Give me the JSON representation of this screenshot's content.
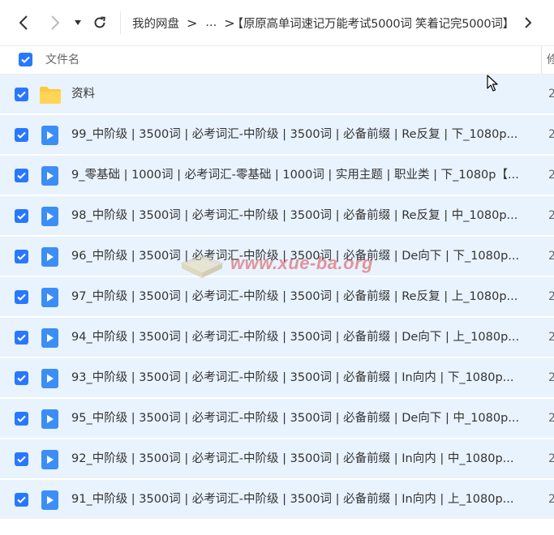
{
  "nav": {
    "back_icon": "chevron-left-icon",
    "forward_icon": "chevron-right-icon",
    "dropdown_icon": "caret-down-icon",
    "refresh_icon": "refresh-icon"
  },
  "breadcrumb": {
    "root": "我的网盘",
    "separator": ">",
    "ellipsis": "...",
    "current": "【原原高单词速记万能考试5000词 笑着记完5000词】",
    "next_icon": "chevron-right-icon"
  },
  "header": {
    "name_label": "文件名",
    "col2_label": "修",
    "select_all_checked": true
  },
  "watermark": {
    "text": "www.xue-ba.org"
  },
  "files": [
    {
      "name": "资料",
      "type": "folder",
      "col2": "2",
      "checked": true
    },
    {
      "name": "99_中阶级 | 3500词 | 必考词汇-中阶级 | 3500词 | 必备前缀 | Re反复 | 下_1080p...",
      "type": "video",
      "col2": "2",
      "checked": true
    },
    {
      "name": "9_零基础 | 1000词 | 必考词汇-零基础 | 1000词 | 实用主题 | 职业类 | 下_1080p【...",
      "type": "video",
      "col2": "2",
      "checked": true
    },
    {
      "name": "98_中阶级 | 3500词 | 必考词汇-中阶级 | 3500词 | 必备前缀 | Re反复 | 中_1080p...",
      "type": "video",
      "col2": "2",
      "checked": true
    },
    {
      "name": "96_中阶级 | 3500词 | 必考词汇-中阶级 | 3500词 | 必备前缀 | De向下 | 下_1080p...",
      "type": "video",
      "col2": "2",
      "checked": true
    },
    {
      "name": "97_中阶级 | 3500词 | 必考词汇-中阶级 | 3500词 | 必备前缀 | Re反复 | 上_1080p...",
      "type": "video",
      "col2": "2",
      "checked": true
    },
    {
      "name": "94_中阶级 | 3500词 | 必考词汇-中阶级 | 3500词 | 必备前缀 | De向下 | 上_1080p...",
      "type": "video",
      "col2": "2",
      "checked": true
    },
    {
      "name": "93_中阶级 | 3500词 | 必考词汇-中阶级 | 3500词 | 必备前缀 | In向内 | 下_1080p...",
      "type": "video",
      "col2": "2",
      "checked": true
    },
    {
      "name": "95_中阶级 | 3500词 | 必考词汇-中阶级 | 3500词 | 必备前缀 | De向下 | 中_1080p...",
      "type": "video",
      "col2": "2",
      "checked": true
    },
    {
      "name": "92_中阶级 | 3500词 | 必考词汇-中阶级 | 3500词 | 必备前缀 | In向内 | 中_1080p...",
      "type": "video",
      "col2": "2",
      "checked": true
    },
    {
      "name": "91_中阶级 | 3500词 | 必考词汇-中阶级 | 3500词 | 必备前缀 | In向内 | 上_1080p...",
      "type": "video",
      "col2": "2",
      "checked": true
    }
  ],
  "colors": {
    "accent": "#2878ff",
    "row_selected_bg": "#e9f3fe",
    "folder": "#ffc83d",
    "video_icon": "#3b8ef5"
  }
}
